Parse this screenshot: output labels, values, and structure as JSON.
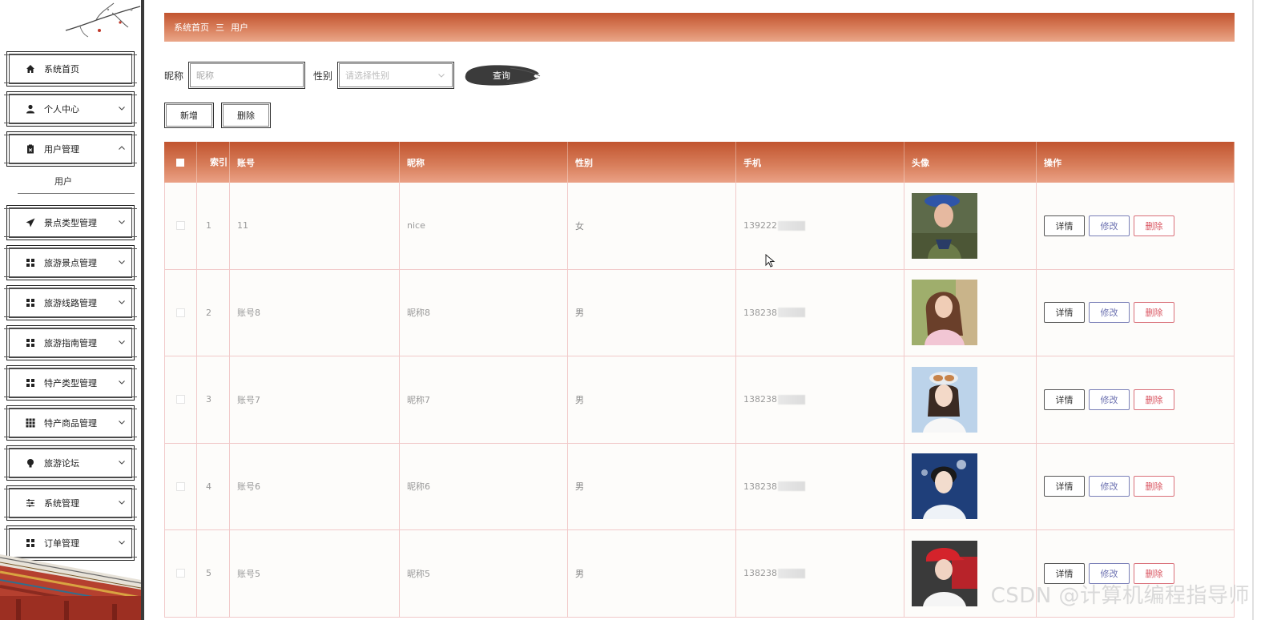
{
  "sidebar": {
    "items": [
      {
        "label": "系统首页",
        "icon": "home-icon",
        "has_chevron": false
      },
      {
        "label": "个人中心",
        "icon": "user-icon",
        "has_chevron": true
      },
      {
        "label": "用户管理",
        "icon": "clipboard-icon",
        "has_chevron": true,
        "expanded": true
      },
      {
        "label": "景点类型管理",
        "icon": "paper-plane-icon",
        "has_chevron": true
      },
      {
        "label": "旅游景点管理",
        "icon": "grid-icon",
        "has_chevron": true
      },
      {
        "label": "旅游线路管理",
        "icon": "grid-icon",
        "has_chevron": true
      },
      {
        "label": "旅游指南管理",
        "icon": "grid-icon",
        "has_chevron": true
      },
      {
        "label": "特产类型管理",
        "icon": "grid-icon",
        "has_chevron": true
      },
      {
        "label": "特产商品管理",
        "icon": "apps-icon",
        "has_chevron": true
      },
      {
        "label": "旅游论坛",
        "icon": "bulb-icon",
        "has_chevron": true
      },
      {
        "label": "系统管理",
        "icon": "sliders-icon",
        "has_chevron": true
      },
      {
        "label": "订单管理",
        "icon": "grid-icon",
        "has_chevron": true
      }
    ],
    "submenu": {
      "label": "用户"
    }
  },
  "breadcrumb": {
    "home": "系统首页",
    "separator": "三",
    "current": "用户"
  },
  "search": {
    "nickname_label": "昵称",
    "nickname_placeholder": "昵称",
    "gender_label": "性别",
    "gender_placeholder": "请选择性别",
    "query_label": "查询"
  },
  "actions": {
    "add_label": "新增",
    "delete_label": "删除"
  },
  "table": {
    "headers": [
      "索引",
      "账号",
      "昵称",
      "性别",
      "手机",
      "头像",
      "操作"
    ],
    "rows": [
      {
        "index": "1",
        "account": "11",
        "nickname": "nice",
        "gender": "女",
        "phone": "139222",
        "avatar": "avatar-soldier-woman"
      },
      {
        "index": "2",
        "account": "账号8",
        "nickname": "昵称8",
        "gender": "男",
        "phone": "138238",
        "avatar": "avatar-pink-dress"
      },
      {
        "index": "3",
        "account": "账号7",
        "nickname": "昵称7",
        "gender": "男",
        "phone": "138238",
        "avatar": "avatar-goggles-girl"
      },
      {
        "index": "4",
        "account": "账号6",
        "nickname": "昵称6",
        "gender": "男",
        "phone": "138238",
        "avatar": "avatar-young-man"
      },
      {
        "index": "5",
        "account": "账号5",
        "nickname": "昵称5",
        "gender": "男",
        "phone": "138238",
        "avatar": "avatar-red-cap"
      }
    ],
    "op_labels": {
      "detail": "详情",
      "edit": "修改",
      "delete": "删除"
    }
  },
  "watermark": "CSDN @计算机编程指导师",
  "colors": {
    "accent": "#c1542f",
    "accent_light": "#eaa789",
    "edit": "#6b70b0",
    "danger": "#d9535f",
    "row_border": "#f1c9c9"
  }
}
